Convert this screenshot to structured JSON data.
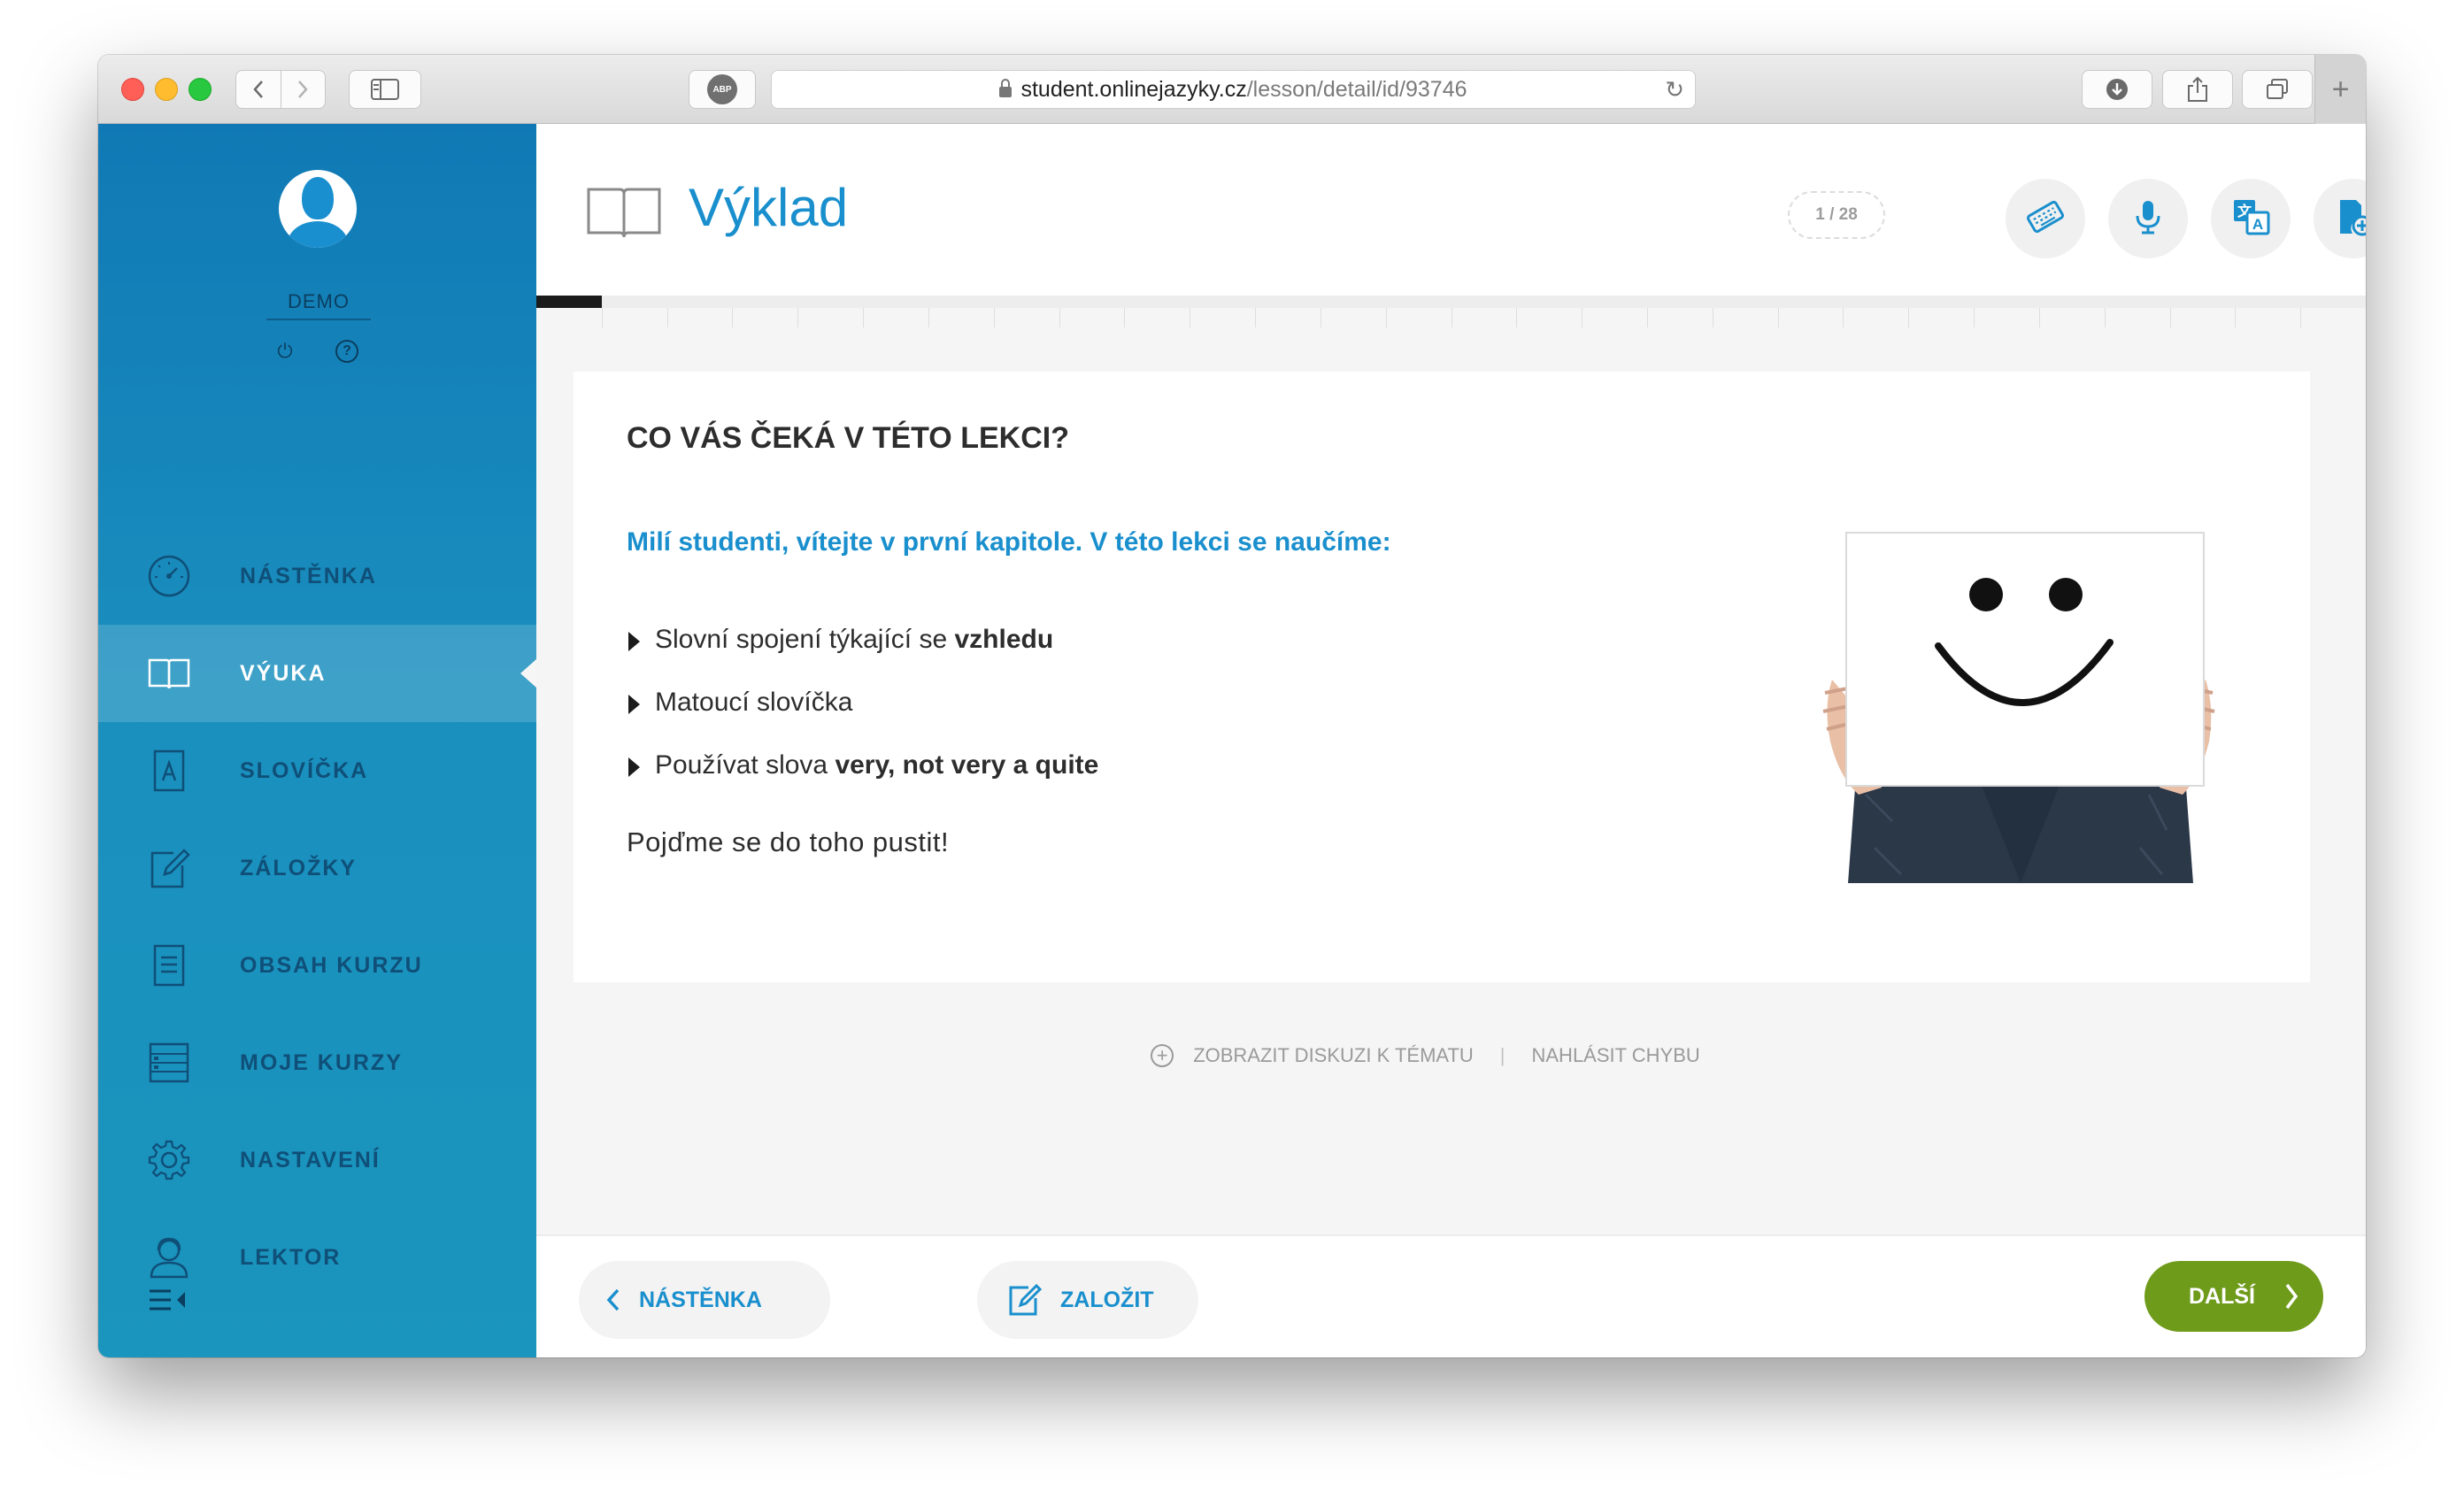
{
  "browser": {
    "url_domain": "student.onlinejazyky.cz",
    "url_path": "/lesson/detail/id/93746",
    "adblock_label": "ABP"
  },
  "sidebar": {
    "username": "DEMO",
    "items": [
      {
        "label": "NÁSTĚNKA",
        "icon": "dashboard-icon"
      },
      {
        "label": "VÝUKA",
        "icon": "book-icon",
        "active": true
      },
      {
        "label": "SLOVÍČKA",
        "icon": "vocabulary-icon"
      },
      {
        "label": "ZÁLOŽKY",
        "icon": "bookmark-edit-icon"
      },
      {
        "label": "OBSAH KURZU",
        "icon": "document-icon"
      },
      {
        "label": "MOJE KURZY",
        "icon": "list-icon"
      },
      {
        "label": "NASTAVENÍ",
        "icon": "gear-icon"
      },
      {
        "label": "LEKTOR",
        "icon": "tutor-icon"
      }
    ]
  },
  "header": {
    "title": "Výklad",
    "counter": "1 / 28",
    "tools": [
      "keyboard-icon",
      "microphone-icon",
      "translate-icon",
      "add-document-icon"
    ]
  },
  "progress": {
    "current": 1,
    "total": 28
  },
  "lesson": {
    "heading": "CO VÁS ČEKÁ V TÉTO LEKCI?",
    "intro": "Milí studenti, vítejte v první kapitole. V této lekci se naučíme:",
    "bullets": [
      {
        "text": "Slovní spojení týkající se ",
        "bold": "vzhledu"
      },
      {
        "text": "Matoucí slovíčka",
        "bold": ""
      },
      {
        "text": "Používat slova ",
        "bold": "very, not very a quite"
      }
    ],
    "outro": "Pojďme se do toho pustit!"
  },
  "links": {
    "discussion": "ZOBRAZIT DISKUZI K TÉMATU",
    "separator": "|",
    "report": "NAHLÁSIT CHYBU"
  },
  "footer": {
    "back_label": "NÁSTĚNKA",
    "bookmark_label": "ZALOŽIT",
    "next_label": "DALŠÍ"
  },
  "colors": {
    "accent": "#1a8fcd",
    "sidebar": "#1a8fbe",
    "next_button": "#6f9b1b"
  }
}
